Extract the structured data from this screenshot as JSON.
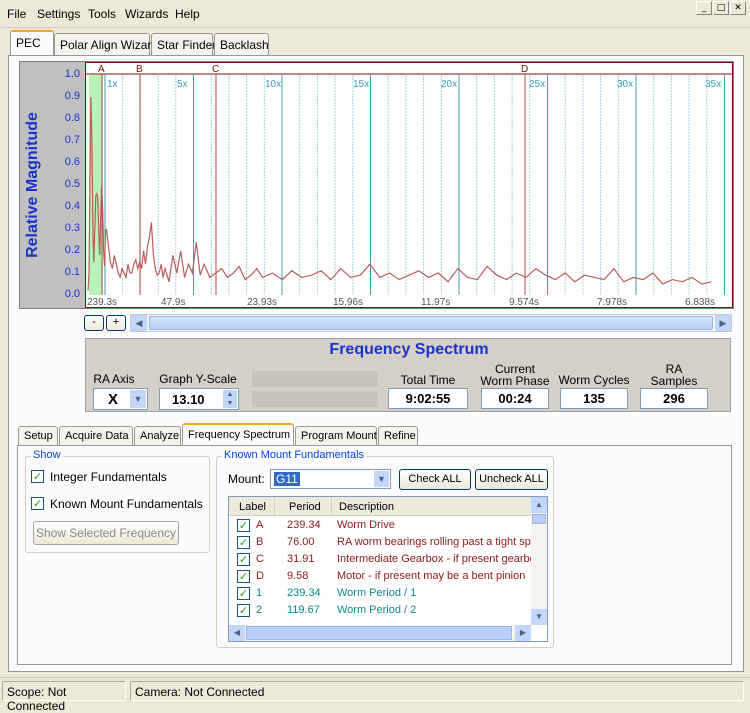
{
  "menu": [
    "File",
    "Settings",
    "Tools",
    "Wizards",
    "Help"
  ],
  "window_controls": {
    "minimize": "_",
    "maximize": "□",
    "close": "✕"
  },
  "top_tabs": [
    "PEC",
    "Polar Align Wizard",
    "Star Finder",
    "Backlash"
  ],
  "chart_data": {
    "type": "line",
    "ylabel": "Relative Magnitude",
    "ylim": [
      0,
      1.0
    ],
    "yticks": [
      "1.0",
      "0.9",
      "0.8",
      "0.7",
      "0.6",
      "0.5",
      "0.4",
      "0.3",
      "0.2",
      "0.1",
      "0.0"
    ],
    "xticks": [
      "239.3s",
      "47.9s",
      "23.93s",
      "15.96s",
      "11.97s",
      "9.574s",
      "7.978s",
      "6.838s"
    ],
    "harmonic_labels": [
      "1x",
      "5x",
      "10x",
      "15x",
      "20x",
      "25x",
      "30x",
      "35x"
    ],
    "markers": [
      "A",
      "B",
      "C",
      "D"
    ],
    "x": [
      1,
      2,
      3,
      4,
      5,
      6,
      7,
      8,
      9,
      10,
      11,
      12,
      13,
      14,
      15,
      16,
      17,
      18,
      19,
      20,
      22,
      24,
      26,
      28,
      30,
      32,
      34,
      36,
      38,
      40,
      42,
      44,
      46,
      48,
      50,
      52,
      54,
      56,
      58,
      60,
      62,
      64,
      66,
      68,
      70,
      72,
      74,
      76,
      78,
      80,
      84,
      88,
      92,
      96,
      100,
      104,
      108,
      112,
      116,
      120,
      126,
      132,
      138,
      144,
      150,
      156,
      162,
      168,
      174,
      180,
      190,
      200,
      210,
      220,
      230,
      240,
      250,
      260,
      270,
      280,
      290,
      300,
      310,
      320,
      330,
      340,
      350,
      360,
      370,
      380,
      390,
      400,
      410,
      420,
      430,
      440,
      450,
      460,
      470,
      480,
      490,
      500,
      510,
      520,
      530,
      540,
      550,
      560,
      570,
      580,
      590,
      600,
      610,
      620,
      630,
      640
    ],
    "y": [
      0.02,
      0.1,
      0.5,
      0.9,
      0.7,
      0.3,
      0.15,
      0.3,
      0.45,
      0.46,
      0.44,
      0.3,
      0.18,
      0.34,
      0.5,
      0.4,
      0.2,
      0.13,
      0.28,
      0.3,
      0.22,
      0.15,
      0.12,
      0.18,
      0.14,
      0.1,
      0.08,
      0.12,
      0.1,
      0.08,
      0.14,
      0.1,
      0.1,
      0.14,
      0.16,
      0.12,
      0.15,
      0.12,
      0.2,
      0.14,
      0.22,
      0.26,
      0.33,
      0.18,
      0.12,
      0.09,
      0.1,
      0.14,
      0.08,
      0.12,
      0.06,
      0.18,
      0.1,
      0.2,
      0.08,
      0.14,
      0.1,
      0.24,
      0.09,
      0.14,
      0.08,
      0.1,
      0.12,
      0.08,
      0.1,
      0.13,
      0.07,
      0.09,
      0.12,
      0.08,
      0.1,
      0.07,
      0.11,
      0.08,
      0.09,
      0.11,
      0.07,
      0.12,
      0.08,
      0.09,
      0.14,
      0.08,
      0.1,
      0.07,
      0.09,
      0.11,
      0.08,
      0.1,
      0.06,
      0.12,
      0.08,
      0.07,
      0.13,
      0.09,
      0.07,
      0.1,
      0.08,
      0.12,
      0.09,
      0.07,
      0.1,
      0.06,
      0.09,
      0.08,
      0.07,
      0.12,
      0.06,
      0.08,
      0.07,
      0.1,
      0.05,
      0.07,
      0.06,
      0.08,
      0.05,
      0.06
    ]
  },
  "zoom": {
    "minus": "-",
    "plus": "+"
  },
  "spectrum": {
    "title": "Frequency Spectrum",
    "ra_axis_label": "RA Axis",
    "ra_axis_value": "X",
    "y_scale_label": "Graph Y-Scale",
    "y_scale_value": "13.10",
    "total_time_label": "Total Time",
    "total_time_value": "9:02:55",
    "worm_phase_label": "Current Worm Phase",
    "worm_phase_value": "00:24",
    "worm_cycles_label": "Worm Cycles",
    "worm_cycles_value": "135",
    "ra_samples_label": "RA Samples",
    "ra_samples_value": "296"
  },
  "sub_tabs": [
    "Setup",
    "Acquire Data",
    "Analyze",
    "Frequency Spectrum",
    "Program Mount",
    "Refine"
  ],
  "show": {
    "title": "Show",
    "integer_label": "Integer Fundamentals",
    "known_label": "Known Mount Fundamentals",
    "button": "Show Selected Frequency"
  },
  "known": {
    "title": "Known Mount Fundamentals",
    "mount_label": "Mount:",
    "mount_value": "G11",
    "check_all": "Check ALL",
    "uncheck_all": "Uncheck ALL",
    "headers": [
      "Label",
      "Period",
      "Description"
    ],
    "rows": [
      {
        "label": "A",
        "period": "239.34",
        "desc": "Worm Drive",
        "color": "#8b1a1a"
      },
      {
        "label": "B",
        "period": "76.00",
        "desc": "RA worm bearings rolling past a tight spot",
        "color": "#8b1a1a"
      },
      {
        "label": "C",
        "period": "31.91",
        "desc": "Intermediate Gearbox - if present gearbox",
        "color": "#8b1a1a"
      },
      {
        "label": "D",
        "period": "9.58",
        "desc": "Motor - if present may be a bent pinion",
        "color": "#8b1a1a"
      },
      {
        "label": "1",
        "period": "239.34",
        "desc": "Worm Period / 1",
        "color": "#0a8a8a"
      },
      {
        "label": "2",
        "period": "119.67",
        "desc": "Worm Period / 2",
        "color": "#0a8a8a"
      }
    ]
  },
  "status": {
    "scope": "Scope: Not Connected",
    "camera": "Camera: Not Connected"
  }
}
